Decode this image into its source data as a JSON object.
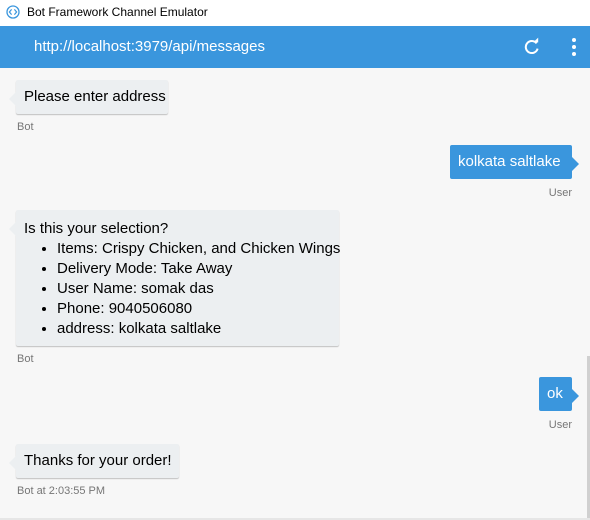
{
  "window": {
    "title": "Bot Framework Channel Emulator"
  },
  "address_bar": {
    "url": "http://localhost:3979/api/messages",
    "refresh_icon": "refresh-icon",
    "menu_icon": "more-vertical-icon"
  },
  "colors": {
    "accent": "#3a96dd",
    "bot_bubble": "#eceff1",
    "chat_background": "#f7f7f7",
    "meta_text": "#767676"
  },
  "messages": [
    {
      "from": "bot",
      "text": "Please enter address",
      "meta": "Bot"
    },
    {
      "from": "user",
      "text": "kolkata saltlake",
      "meta": "User"
    },
    {
      "from": "bot",
      "title": "Is this your selection?",
      "items": [
        "Items: Crispy Chicken, and Chicken Wings",
        "Delivery Mode: Take Away",
        "User Name: somak das",
        "Phone: 9040506080",
        "address: kolkata saltlake"
      ],
      "meta": "Bot"
    },
    {
      "from": "user",
      "text": "ok",
      "meta": "User"
    },
    {
      "from": "bot",
      "text": "Thanks for your order!",
      "meta": "Bot at 2:03:55 PM"
    }
  ]
}
